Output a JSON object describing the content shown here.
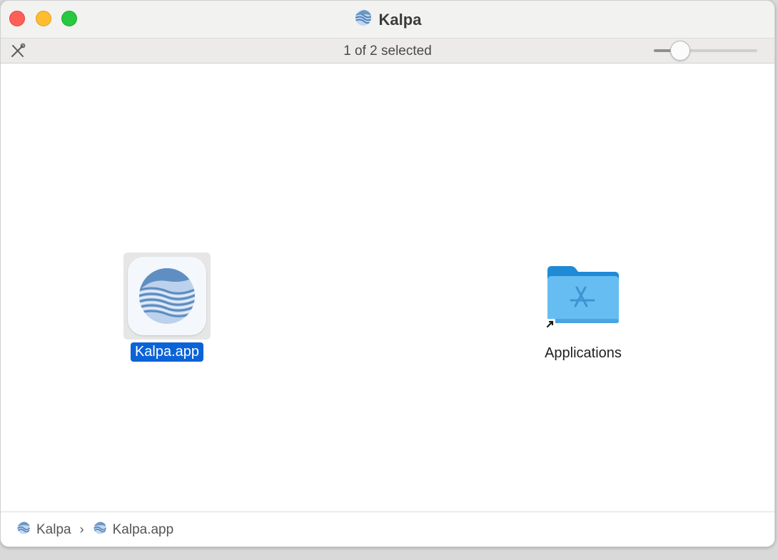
{
  "window": {
    "title": "Kalpa",
    "title_icon": "kalpa-globe-icon"
  },
  "toolbar": {
    "status": "1 of 2 selected",
    "tool_icon": "tools-icon",
    "icon_size_slider": {
      "value": 0.25
    }
  },
  "items": [
    {
      "name": "Kalpa.app",
      "icon": "kalpa-app-icon",
      "selected": true
    },
    {
      "name": "Applications",
      "icon": "applications-folder-alias-icon",
      "selected": false
    }
  ],
  "pathbar": {
    "segments": [
      "Kalpa",
      "Kalpa.app"
    ],
    "separator": "›"
  },
  "colors": {
    "selection": "#0b63d8",
    "folder": "#66bdf2",
    "close": "#fe5f57",
    "minimize": "#febc2e",
    "zoom": "#28c840"
  }
}
